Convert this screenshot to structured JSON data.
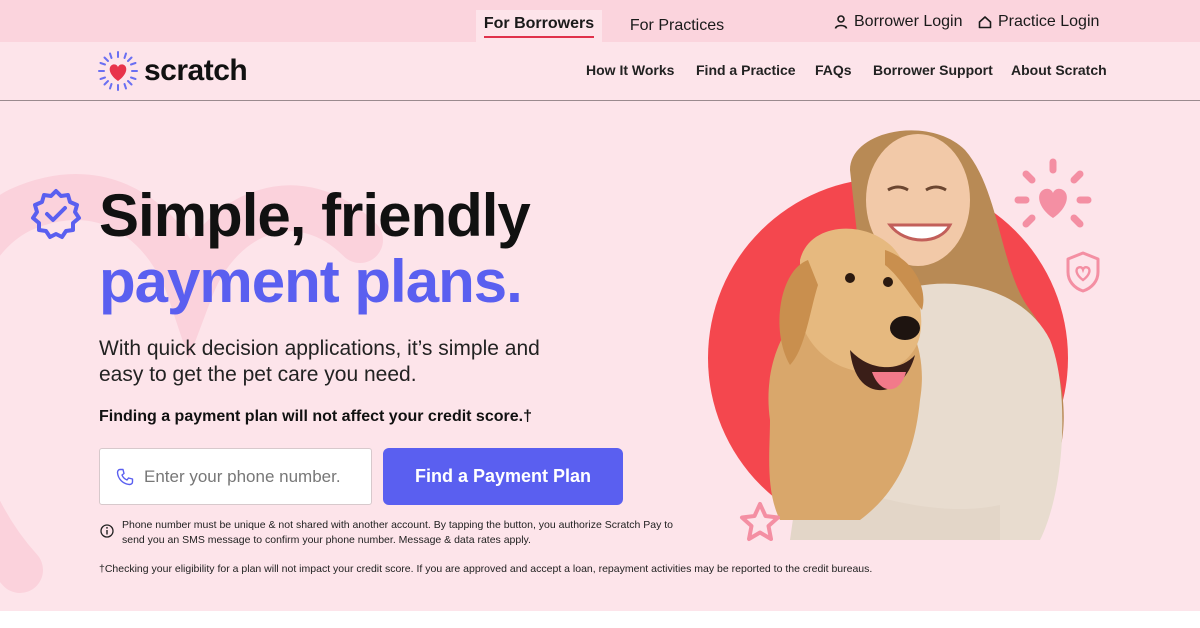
{
  "audience_tabs": [
    {
      "label": "For Borrowers",
      "active": true
    },
    {
      "label": "For Practices",
      "active": false
    }
  ],
  "utility_links": {
    "borrower_login": {
      "label": "Borrower Login",
      "icon": "person-icon"
    },
    "practice_login": {
      "label": "Practice Login",
      "icon": "home-icon"
    }
  },
  "brand": {
    "name": "scratch",
    "logo_icon": "heart-burst-icon",
    "heart_color": "#e8334a"
  },
  "nav": {
    "items": [
      "How It Works",
      "Find a Practice",
      "FAQs",
      "Borrower Support",
      "About Scratch"
    ]
  },
  "hero": {
    "headline_line1": "Simple, friendly",
    "headline_line2": "payment plans.",
    "subheadline": "With quick decision applications, it’s simple and easy to get the pet care you need.",
    "credit_note": "Finding a payment plan will not affect your credit score.†",
    "phone_placeholder": "Enter your phone number.",
    "cta_label": "Find a Payment Plan",
    "disclaimer": "Phone number must be unique & not shared with another account. By tapping the button, you authorize Scratch Pay to send you an SMS message to confirm your phone number. Message & data rates apply.",
    "footnote": "†Checking your eligibility for a plan will not impact your credit score. If you are approved and accept a loan, repayment activities may be reported to the credit bureaus."
  },
  "colors": {
    "accent": "#5a5ff0",
    "page_bg": "#fde4ea",
    "topbar_bg": "#fbd4dd",
    "circle": "#f4474e",
    "deco_pink": "#f48fa3"
  }
}
